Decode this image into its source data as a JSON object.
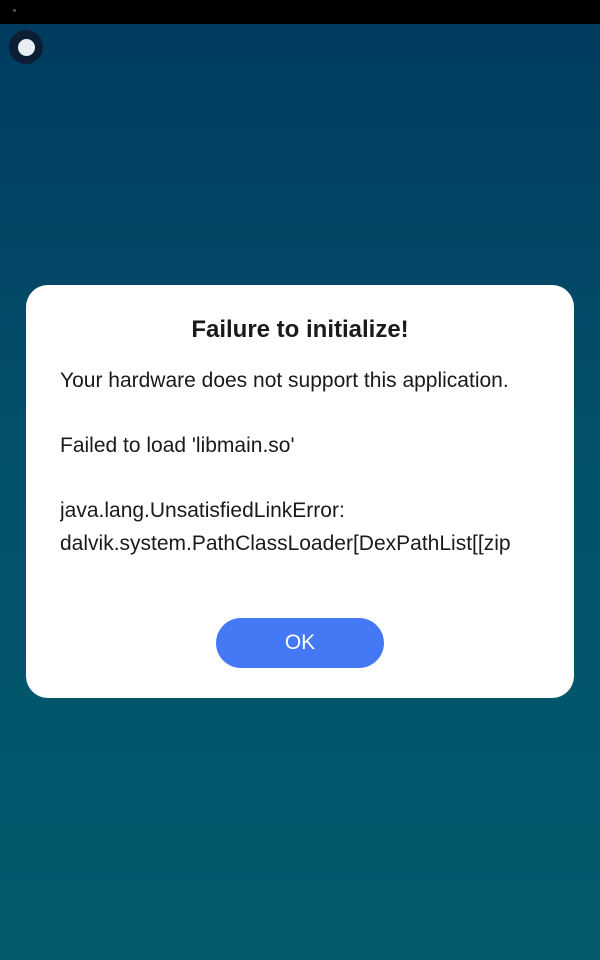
{
  "dialog": {
    "title": "Failure to initialize!",
    "message_line1": "Your hardware does not support this application.",
    "message_line2": "Failed to load 'libmain.so'",
    "error_line1": "java.lang.UnsatisfiedLinkError:",
    "error_line2": "dalvik.system.PathClassLoader[DexPathList[[zip",
    "ok_label": "OK"
  },
  "colors": {
    "background_top": "#013a5e",
    "background_bottom": "#035b6d",
    "dialog_background": "#ffffff",
    "accent_button": "#4478f5"
  },
  "icons": {
    "overlay_button": "floating-circle-icon"
  }
}
